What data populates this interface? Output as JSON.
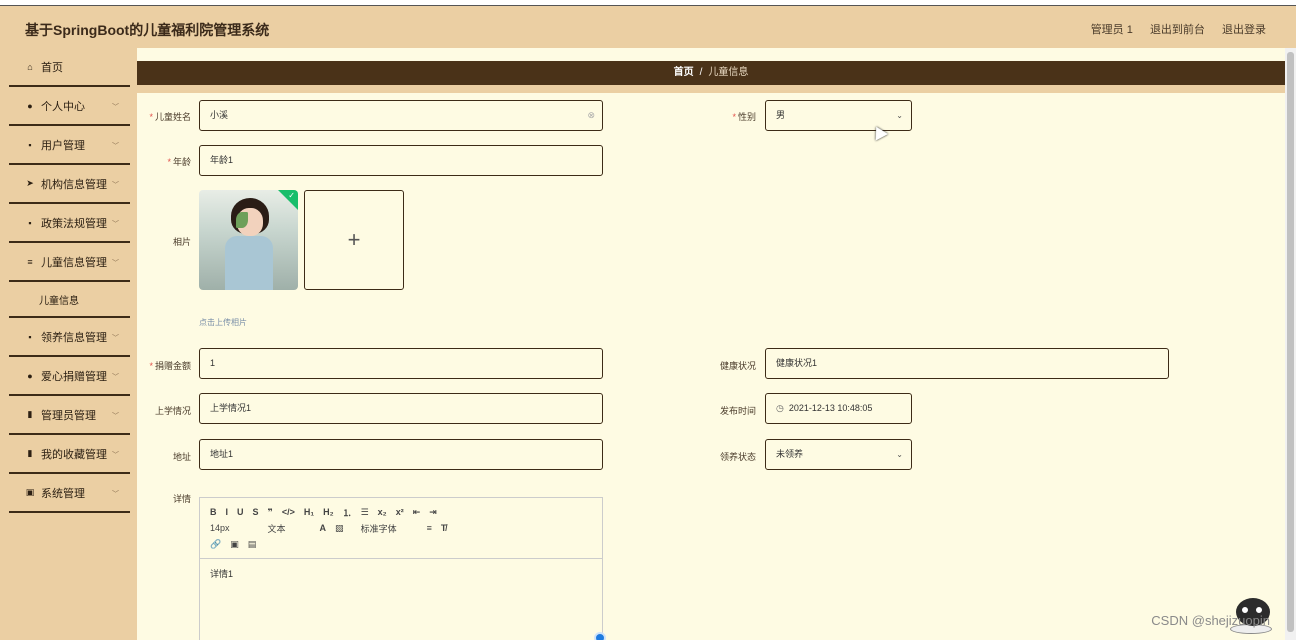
{
  "app": {
    "title": "基于SpringBoot的儿童福利院管理系统",
    "user": "管理员 1",
    "link_front": "退出到前台",
    "link_logout": "退出登录"
  },
  "sidebar": {
    "items": [
      {
        "label": "首页",
        "icon": "home-icon",
        "glyph": "⌂"
      },
      {
        "label": "个人中心",
        "icon": "user-icon",
        "glyph": "●"
      },
      {
        "label": "用户管理",
        "icon": "grid-icon",
        "glyph": "▪"
      },
      {
        "label": "机构信息管理",
        "icon": "send-icon",
        "glyph": "➤"
      },
      {
        "label": "政策法规管理",
        "icon": "grid-icon",
        "glyph": "▪"
      },
      {
        "label": "儿童信息管理",
        "icon": "list-icon",
        "glyph": "≡"
      },
      {
        "label": "领养信息管理",
        "icon": "grid-icon",
        "glyph": "▪"
      },
      {
        "label": "爱心捐赠管理",
        "icon": "user-icon",
        "glyph": "●"
      },
      {
        "label": "管理员管理",
        "icon": "chart-icon",
        "glyph": "▮"
      },
      {
        "label": "我的收藏管理",
        "icon": "bar-chart-icon",
        "glyph": "▮"
      },
      {
        "label": "系统管理",
        "icon": "clipboard-icon",
        "glyph": "▣"
      }
    ],
    "subitem": "儿童信息"
  },
  "breadcrumb": {
    "home": "首页",
    "sep": "/",
    "current": "儿童信息"
  },
  "form": {
    "name_label": "儿童姓名",
    "name_value": "小溪",
    "gender_label": "性别",
    "gender_value": "男",
    "age_label": "年龄",
    "age_value": "年龄1",
    "photo_label": "相片",
    "upload_plus": "+",
    "upload_hint": "点击上传相片",
    "amount_label": "捐赠金额",
    "amount_value": "1",
    "health_label": "健康状况",
    "health_value": "健康状况1",
    "school_label": "上学情况",
    "school_value": "上学情况1",
    "date_label": "发布时间",
    "date_value": "2021-12-13 10:48:05",
    "address_label": "地址",
    "address_value": "地址1",
    "adopt_label": "领养状态",
    "adopt_value": "未领养",
    "detail_label": "详情",
    "required_mark": "*"
  },
  "editor": {
    "row1": [
      "B",
      "I",
      "U",
      "S",
      "❞",
      "</>",
      "H₁",
      "H₂",
      "⒈",
      "☰",
      "x₂",
      "x²",
      "⇤",
      "⇥"
    ],
    "size": "14px",
    "text_type": "文本",
    "font": "标准字体",
    "content": "详情1"
  },
  "watermark": "CSDN @shejizuopin"
}
